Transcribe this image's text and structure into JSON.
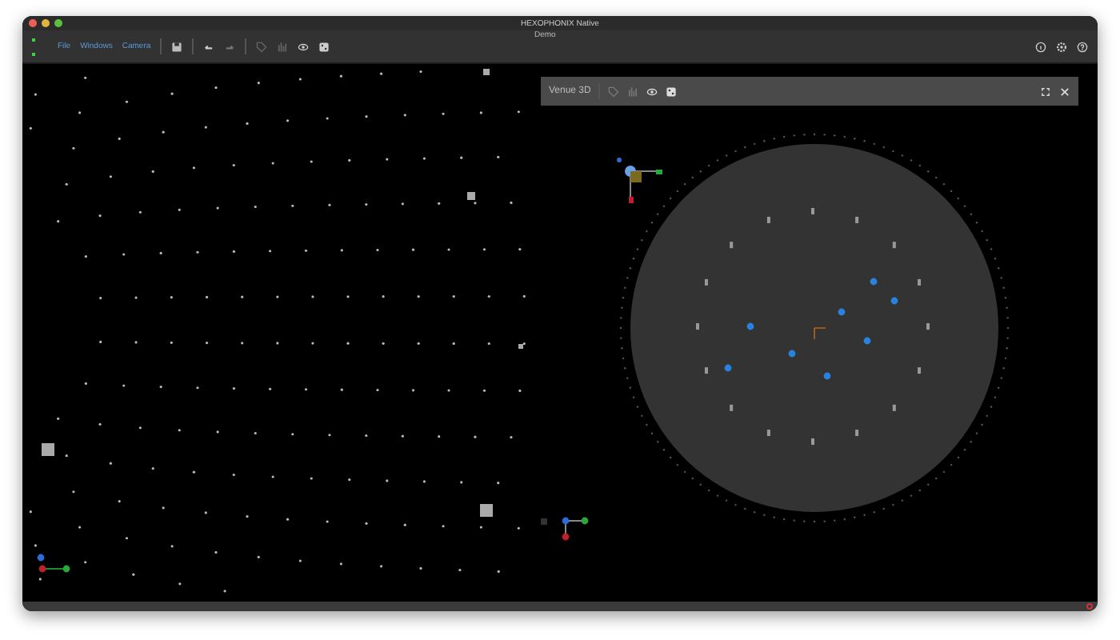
{
  "window": {
    "title": "HEXOPHONIX Native",
    "subtitle": "Demo"
  },
  "menu": [
    {
      "label": "File"
    },
    {
      "label": "Windows"
    },
    {
      "label": "Camera"
    }
  ],
  "panel": {
    "title": "Venue 3D"
  }
}
